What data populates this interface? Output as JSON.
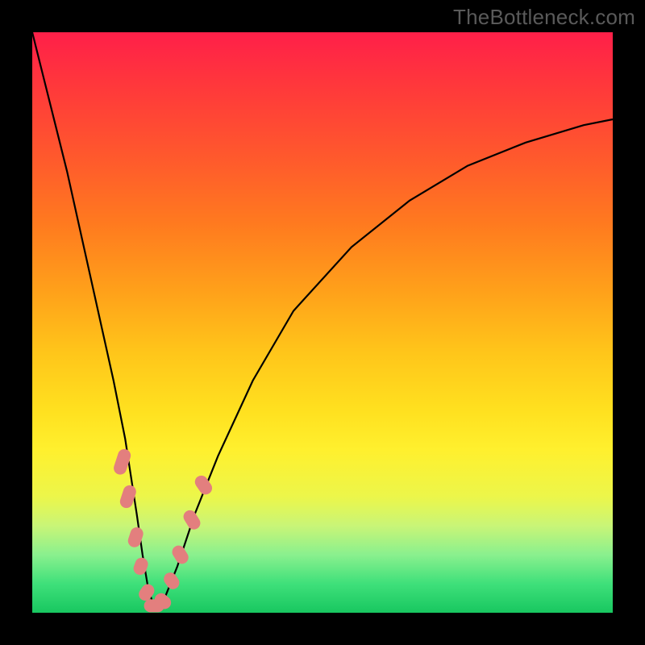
{
  "watermark": "TheBottleneck.com",
  "colors": {
    "frame": "#000000",
    "marker": "#e37f7e",
    "curve": "#000000"
  },
  "chart_data": {
    "type": "line",
    "title": "",
    "xlabel": "",
    "ylabel": "",
    "xlim": [
      0,
      100
    ],
    "ylim": [
      0,
      100
    ],
    "grid": false,
    "note": "Axes have no visible tick labels or numeric scale in the source image; x and y are normalised 0–100. y represents bottleneck percentage (high at top, 0 at bottom). The curve descends steeply from the left, reaches ~0 near x≈21, then rises asymptotically toward the right.",
    "series": [
      {
        "name": "bottleneck-curve",
        "x": [
          0,
          2,
          4,
          6,
          8,
          10,
          12,
          14,
          16,
          18,
          19,
          20,
          21,
          22,
          23,
          25,
          28,
          32,
          38,
          45,
          55,
          65,
          75,
          85,
          95,
          100
        ],
        "y": [
          100,
          92,
          84,
          76,
          67,
          58,
          49,
          40,
          30,
          17,
          10,
          4,
          1,
          1,
          3,
          8,
          17,
          27,
          40,
          52,
          63,
          71,
          77,
          81,
          84,
          85
        ]
      }
    ],
    "markers": {
      "name": "highlighted-points",
      "note": "Pink capsule-shaped markers clustered near the curve minimum, along both the descending and ascending branches.",
      "points": [
        {
          "x": 15.5,
          "y": 26,
          "angle": -72,
          "len": 4.5
        },
        {
          "x": 16.5,
          "y": 20,
          "angle": -72,
          "len": 4.0
        },
        {
          "x": 17.8,
          "y": 13,
          "angle": -72,
          "len": 3.5
        },
        {
          "x": 18.7,
          "y": 8,
          "angle": -70,
          "len": 3.0
        },
        {
          "x": 19.7,
          "y": 3.5,
          "angle": -55,
          "len": 3.0
        },
        {
          "x": 21.0,
          "y": 1.2,
          "angle": 0,
          "len": 3.5
        },
        {
          "x": 22.5,
          "y": 2.0,
          "angle": 40,
          "len": 3.0
        },
        {
          "x": 24.0,
          "y": 5.5,
          "angle": 55,
          "len": 3.0
        },
        {
          "x": 25.5,
          "y": 10,
          "angle": 58,
          "len": 3.3
        },
        {
          "x": 27.5,
          "y": 16,
          "angle": 58,
          "len": 3.5
        },
        {
          "x": 29.5,
          "y": 22,
          "angle": 55,
          "len": 3.5
        }
      ]
    }
  }
}
